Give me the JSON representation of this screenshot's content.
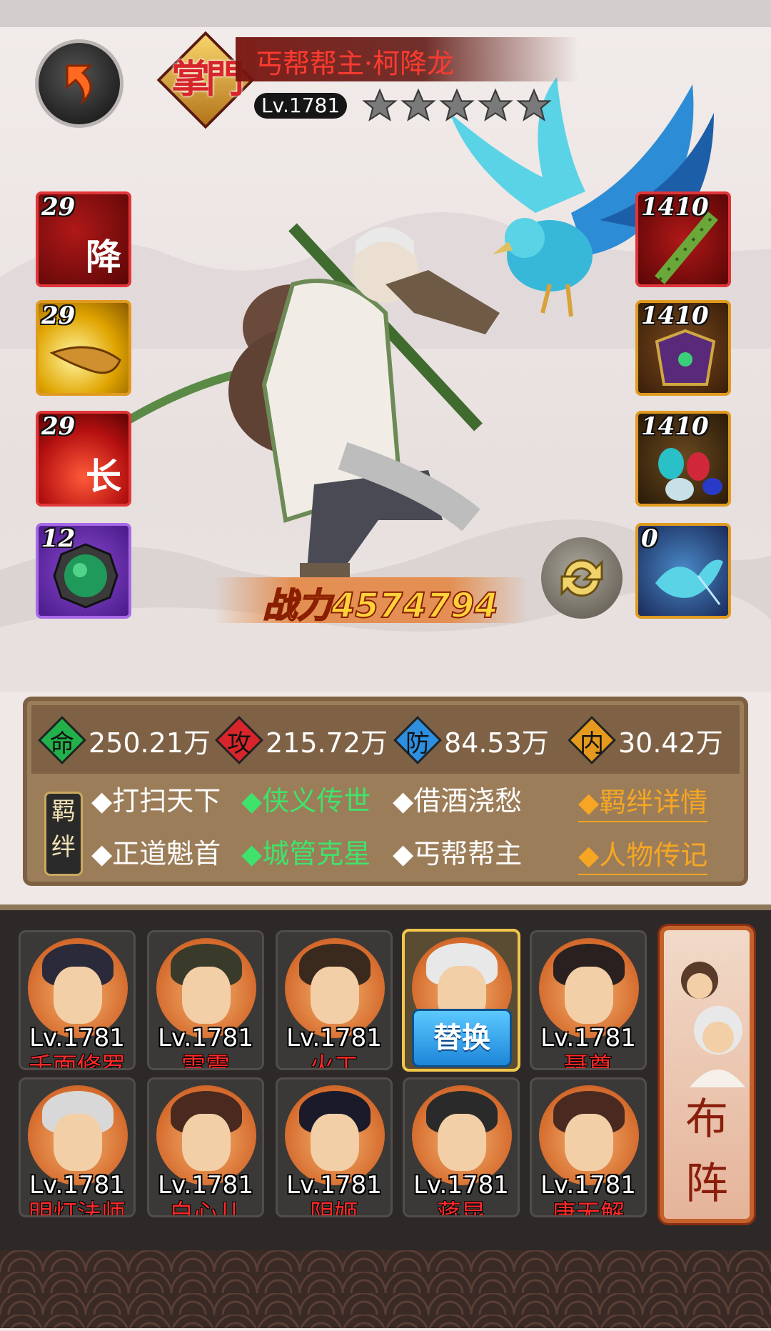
{
  "hero": {
    "badge": "掌門",
    "name": "丐帮帮主·柯降龙",
    "level": "Lv.1781",
    "stars": 5
  },
  "skills_left": [
    {
      "num": "29",
      "glyph": "降",
      "kind": "red-skill"
    },
    {
      "num": "29",
      "glyph": "",
      "kind": "gold-skill"
    },
    {
      "num": "29",
      "glyph": "长",
      "kind": "red-fire-skill"
    },
    {
      "num": "12",
      "glyph": "",
      "kind": "jade-amulet"
    }
  ],
  "equip_right": [
    {
      "num": "1410",
      "kind": "bamboo-staff"
    },
    {
      "num": "1410",
      "kind": "purple-armor"
    },
    {
      "num": "1410",
      "kind": "gem-stones"
    },
    {
      "num": "0",
      "kind": "blue-eagle-pet"
    }
  ],
  "power": {
    "label": "战力4574794"
  },
  "stats": [
    {
      "icon": "命",
      "value": "250.21万",
      "color": "#22b04a"
    },
    {
      "icon": "攻",
      "value": "215.72万",
      "color": "#d8252b"
    },
    {
      "icon": "防",
      "value": "84.53万",
      "color": "#2d8fe0"
    },
    {
      "icon": "内",
      "value": "30.42万",
      "color": "#e59a1d"
    }
  ],
  "bond": {
    "tag": "羁绊",
    "row1": [
      {
        "text": "◆打扫天下",
        "active": false
      },
      {
        "text": "◆侠义传世",
        "active": true
      },
      {
        "text": "◆借酒浇愁",
        "active": false
      }
    ],
    "row2": [
      {
        "text": "◆正道魁首",
        "active": false
      },
      {
        "text": "◆城管克星",
        "active": true
      },
      {
        "text": "◆丐帮帮主",
        "active": false
      }
    ],
    "details_link": "◆羁绊详情",
    "bio_link": "◆人物传记"
  },
  "roster": [
    {
      "level": "Lv.1781",
      "name": "千面修罗"
    },
    {
      "level": "Lv.1781",
      "name": "雷震"
    },
    {
      "level": "Lv.1781",
      "name": "火工"
    },
    {
      "level": "",
      "name": "",
      "selected": true,
      "button": "替换"
    },
    {
      "level": "Lv.1781",
      "name": "聂尊"
    },
    {
      "level": "Lv.1781",
      "name": "明灯法师"
    },
    {
      "level": "Lv.1781",
      "name": "白心儿"
    },
    {
      "level": "Lv.1781",
      "name": "阴姬"
    },
    {
      "level": "Lv.1781",
      "name": "蒋昆"
    },
    {
      "level": "Lv.1781",
      "name": "唐无解"
    }
  ],
  "formation": {
    "label": "布阵"
  },
  "colors": {
    "active_bond": "#3fe36b",
    "link": "#f6a623",
    "name_red": "#ff2a2a"
  }
}
